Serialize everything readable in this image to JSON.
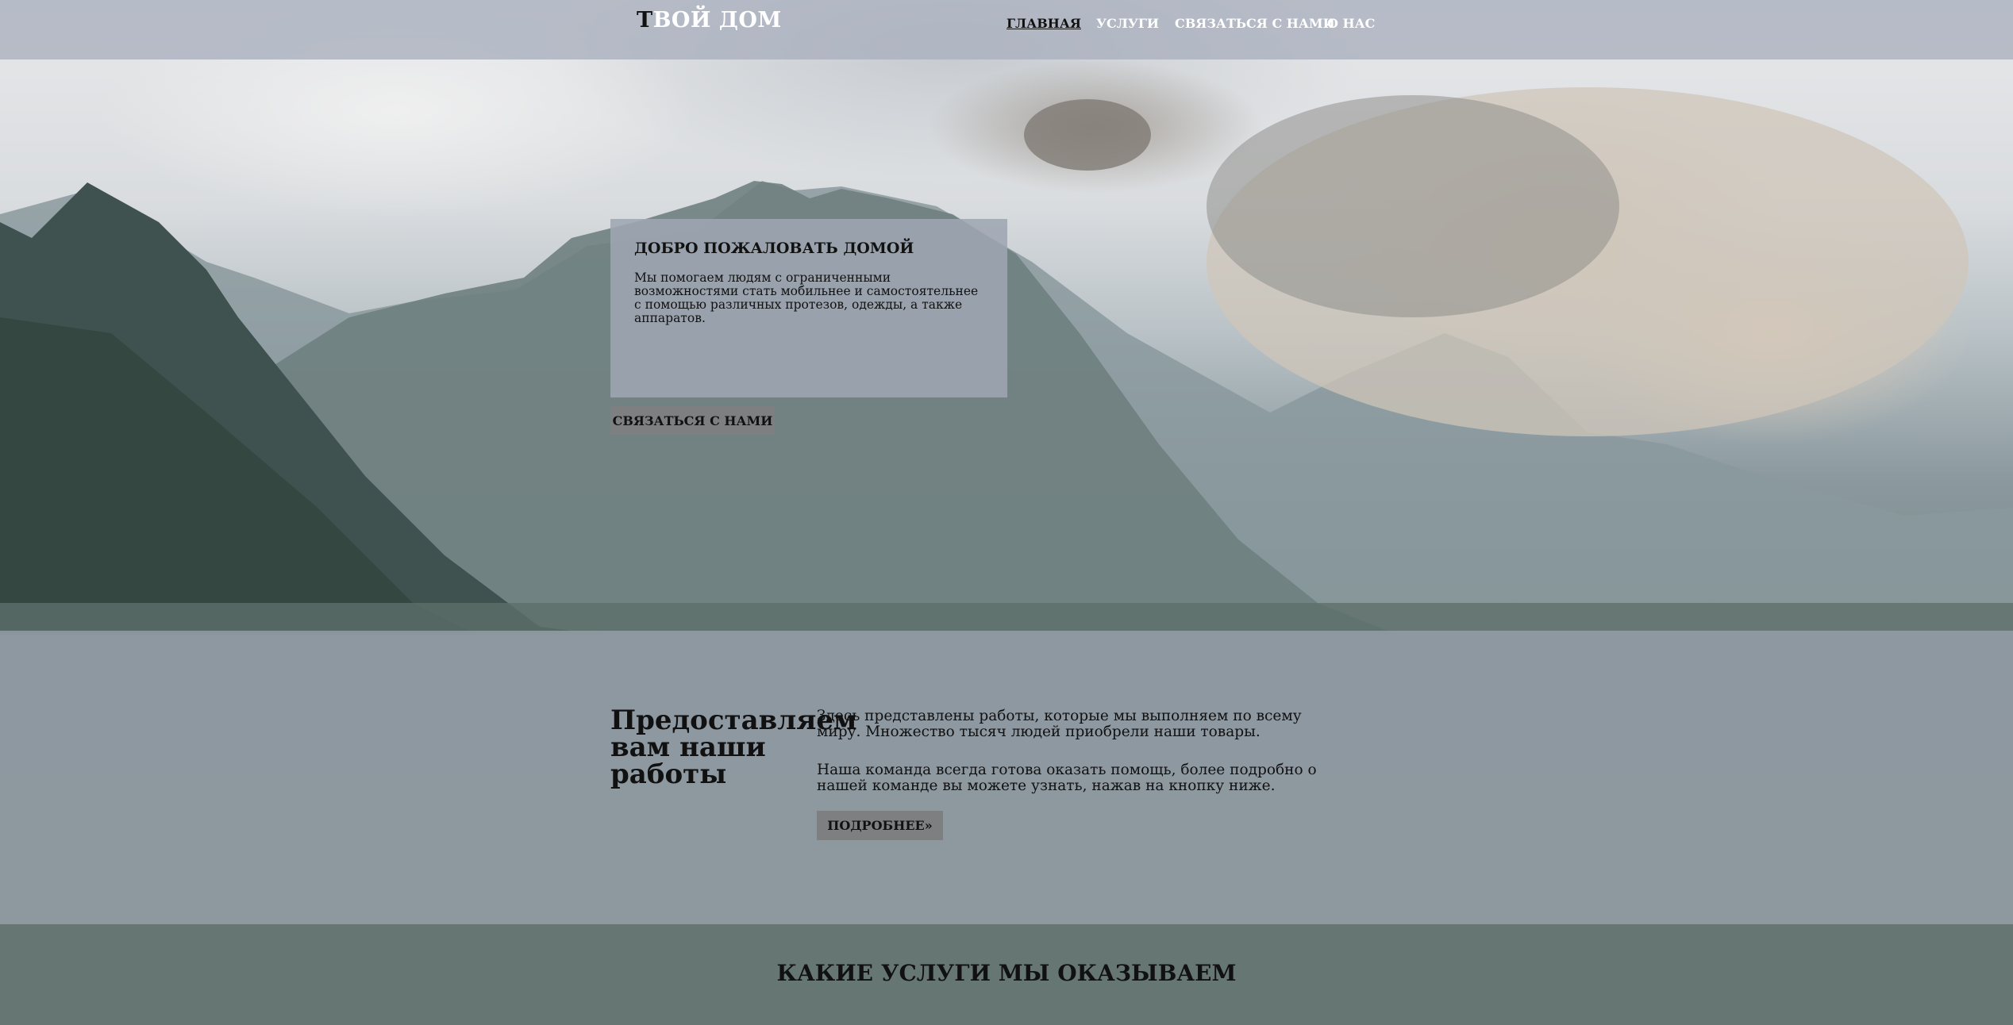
{
  "header": {
    "logo_first": "Т",
    "logo_rest": "ВОЙ ДОМ",
    "nav": [
      {
        "label": "ГЛАВНАЯ",
        "active": true
      },
      {
        "label": "УСЛУГИ",
        "active": false
      },
      {
        "label": "СВЯЗАТЬСЯ С НАМИ",
        "active": false
      },
      {
        "label": "О НАС",
        "active": false
      }
    ]
  },
  "hero": {
    "title": "ДОБРО ПОЖАЛОВАТЬ ДОМОЙ",
    "text": "Мы помогаем людям с ограниченными возможностями стать мобильнее и самостоятельнее с помощью различных протезов, одежды, а также аппаратов.",
    "button_label": "СВЯЗАТЬСЯ С НАМИ"
  },
  "works": {
    "heading": "Предоставляем вам наши работы",
    "paragraph1": "Здесь представлены работы, которые мы выполняем по всему миру. Множество тысяч людей приобрели наши товары.",
    "paragraph2": "Наша команда всегда готова оказать помощь, более подробно о нашей команде вы можете узнать, нажав на кнопку ниже.",
    "button_label": "ПОДРОБНЕЕ»"
  },
  "services": {
    "title": "КАКИЕ УСЛУГИ МЫ ОКАЗЫВАЕМ"
  },
  "colors": {
    "topbar": "#aab0be",
    "card": "#9ea6b2",
    "button": "#7e7f80",
    "band": "#969ea8"
  }
}
